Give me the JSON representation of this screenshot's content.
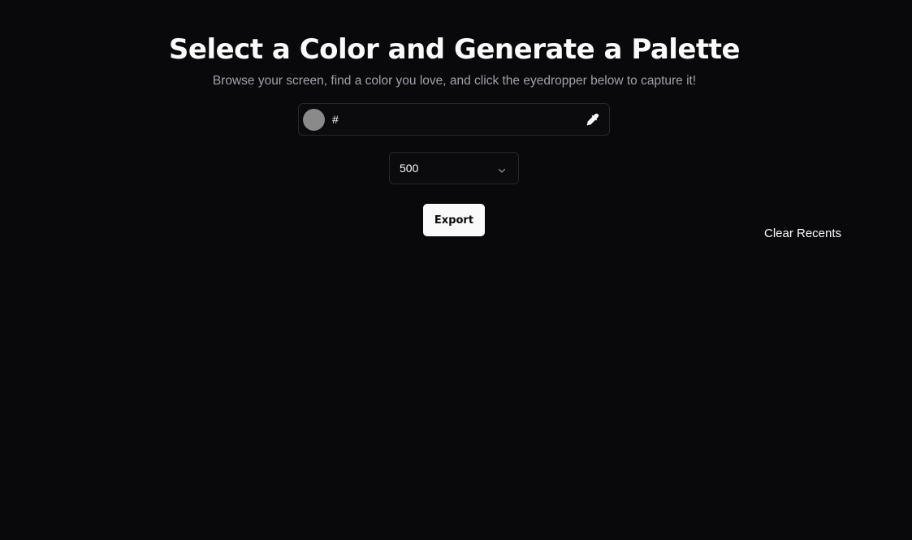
{
  "header": {
    "title": "Select a Color and Generate a Palette",
    "subtitle": "Browse your screen, find a color you love, and click the eyedropper below to capture it!"
  },
  "color_picker": {
    "swatch_color": "#8a8a8a",
    "hex_prefix": "#",
    "hex_value": "",
    "eyedropper_icon": "eyedropper-icon"
  },
  "shade_select": {
    "selected": "500",
    "icon": "chevron-down-icon"
  },
  "actions": {
    "export_label": "Export",
    "clear_recents_label": "Clear Recents"
  },
  "theme": {
    "background": "#09090b",
    "border": "#27272a",
    "foreground": "#fafafa",
    "muted": "#a1a1aa"
  }
}
